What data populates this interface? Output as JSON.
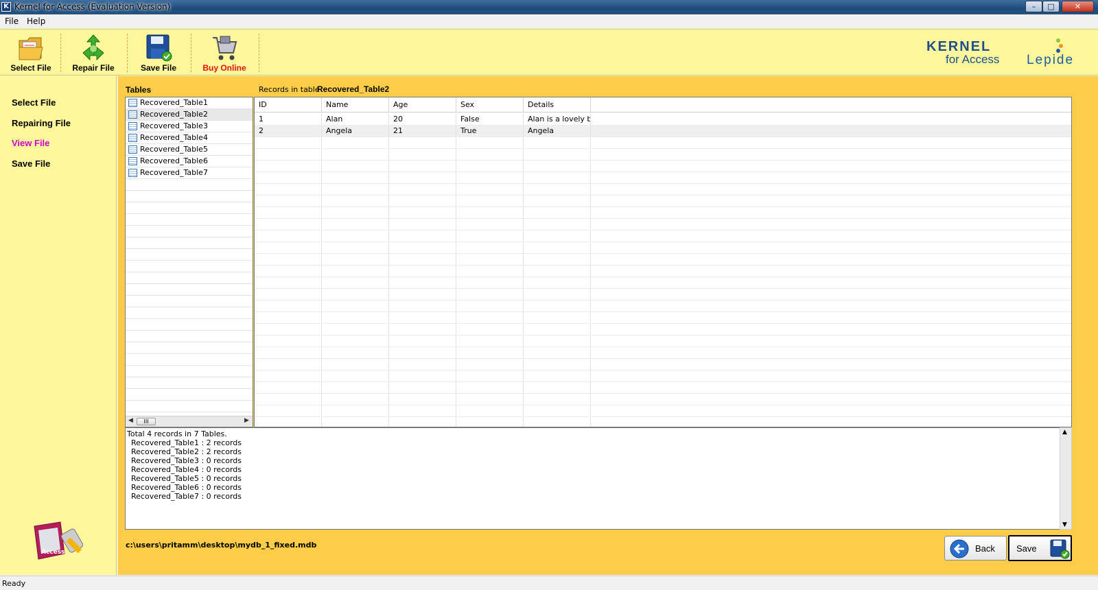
{
  "window": {
    "title": "Kernel for Access (Evaluation Version)",
    "app_icon_letter": "K",
    "controls": {
      "minimize": "–",
      "maximize": "□",
      "close": "✕"
    }
  },
  "menubar": {
    "items": [
      "File",
      "Help"
    ]
  },
  "toolbar": {
    "buttons": [
      {
        "label": "Select File",
        "icon": "folder-icon"
      },
      {
        "label": "Repair File",
        "icon": "recycle-icon"
      },
      {
        "label": "Save File",
        "icon": "floppy-disk-icon"
      },
      {
        "label": "Buy Online",
        "icon": "shopping-cart-icon",
        "color": "#e01010"
      }
    ],
    "brand": {
      "line1": "KERNEL",
      "line2": "for Access",
      "company": "Lepide"
    }
  },
  "leftnav": {
    "items": [
      {
        "label": "Select File",
        "active": false
      },
      {
        "label": "Repairing File",
        "active": false
      },
      {
        "label": "View File",
        "active": true
      },
      {
        "label": "Save File",
        "active": false
      }
    ],
    "active_color": "#cc00cc",
    "logo_text": "Access"
  },
  "main": {
    "tables_label": "Tables",
    "records_label": "Records in table",
    "current_table": "Recovered_Table2",
    "tables": [
      "Recovered_Table1",
      "Recovered_Table2",
      "Recovered_Table3",
      "Recovered_Table4",
      "Recovered_Table5",
      "Recovered_Table6",
      "Recovered_Table7"
    ],
    "selected_table_index": 1,
    "hscroll_thumb": "III",
    "grid": {
      "columns": [
        "ID",
        "Name",
        "Age",
        "Sex",
        "Details"
      ],
      "rows": [
        [
          "1",
          "Alan",
          "20",
          "False",
          "Alan is a lovely b..."
        ],
        [
          "2",
          "Angela",
          "21",
          "True",
          "Angela                ..."
        ]
      ]
    },
    "summary": {
      "header": "Total 4 records in 7 Tables.",
      "lines": [
        "Recovered_Table1 : 2 records",
        "Recovered_Table2 : 2 records",
        "Recovered_Table3 : 0 records",
        "Recovered_Table4 : 0 records",
        "Recovered_Table5 : 0 records",
        "Recovered_Table6 : 0 records",
        "Recovered_Table7 : 0 records"
      ]
    },
    "file_path": "c:\\users\\pritamm\\desktop\\mydb_1_fixed.mdb",
    "back_label": "Back",
    "save_label": "Save"
  },
  "statusbar": {
    "text": "Ready"
  },
  "colors": {
    "toolbar_bg": "#fff79c",
    "main_bg": "#fdcd4a",
    "brand_blue": "#1e4f8d",
    "buy_online_red": "#e01010",
    "nav_active": "#cc00cc"
  }
}
